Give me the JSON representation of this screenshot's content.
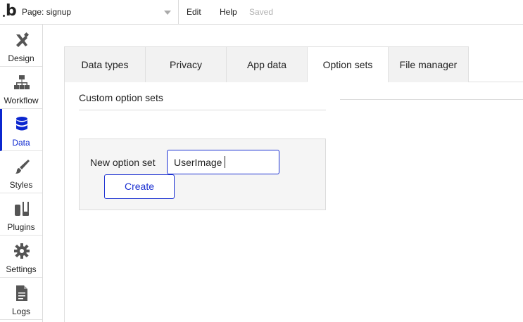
{
  "topbar": {
    "logo": "b",
    "page_label": "Page: signup",
    "edit": "Edit",
    "help": "Help",
    "saved": "Saved"
  },
  "sidebar": {
    "items": [
      {
        "label": "Design",
        "icon": "design-icon"
      },
      {
        "label": "Workflow",
        "icon": "workflow-icon"
      },
      {
        "label": "Data",
        "icon": "database-icon",
        "active": true
      },
      {
        "label": "Styles",
        "icon": "brush-icon"
      },
      {
        "label": "Plugins",
        "icon": "plugins-icon"
      },
      {
        "label": "Settings",
        "icon": "gear-icon"
      },
      {
        "label": "Logs",
        "icon": "document-icon"
      }
    ]
  },
  "tabs": [
    {
      "label": "Data types"
    },
    {
      "label": "Privacy"
    },
    {
      "label": "App data"
    },
    {
      "label": "Option sets",
      "active": true
    },
    {
      "label": "File manager"
    }
  ],
  "main": {
    "section_title": "Custom option sets",
    "new_option_label": "New option set",
    "new_option_value": "UserImage",
    "create_label": "Create"
  },
  "colors": {
    "accent": "#0b26cf",
    "border": "#dcdcdc",
    "tab_bg": "#f2f2f2"
  }
}
